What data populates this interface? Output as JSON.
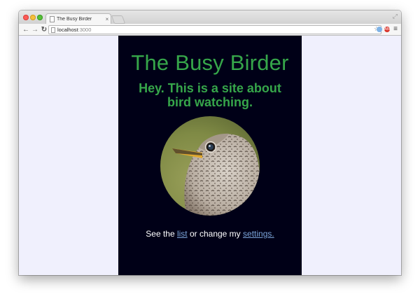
{
  "browser": {
    "tab_title": "The Busy Birder",
    "tab_close_glyph": "×",
    "url_host": "localhost",
    "url_port": ":3000",
    "adblock_badge": "ABP"
  },
  "page": {
    "title": "The Busy Birder",
    "tagline": "Hey. This is a site about bird watching.",
    "footer": {
      "prefix": "See the ",
      "list_link": "list",
      "middle": " or change my ",
      "settings_link": "settings."
    }
  },
  "colors": {
    "page_background": "#000017",
    "viewport_background": "#f0f0fd",
    "heading_green": "#36a64a",
    "link_blue": "#7ba4d8"
  },
  "icons": {
    "back": "back-arrow-icon",
    "forward": "forward-arrow-icon",
    "reload": "reload-icon",
    "bookmark": "star-icon",
    "menu": "menu-icon"
  }
}
